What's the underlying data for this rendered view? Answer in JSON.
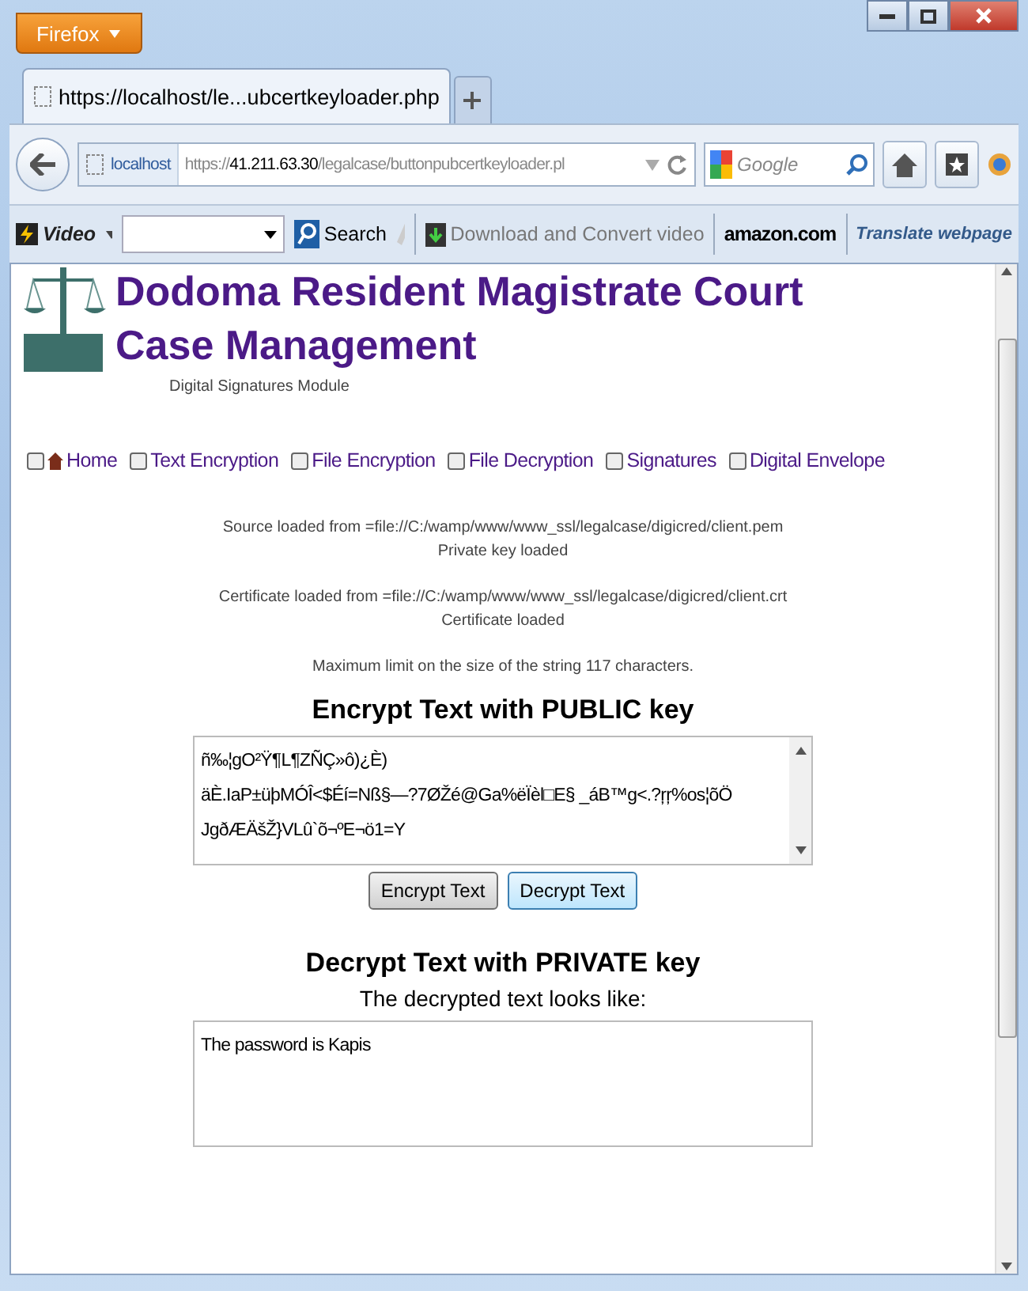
{
  "browser": {
    "app_button": "Firefox",
    "tabs": [
      {
        "label": "https://localhost/le...ubcertkeyloader.php",
        "selected": true
      }
    ],
    "address": {
      "site": "localhost",
      "scheme": "https://",
      "host": "41.211.63.30",
      "path": "/legalcase/buttonpubcertkeyloader.pl"
    },
    "search": {
      "placeholder": "Google"
    }
  },
  "toolbar": {
    "video": "Video",
    "search_button": "Search",
    "download": "Download and Convert video",
    "amazon": "amazon.com",
    "translate": "Translate webpage"
  },
  "page": {
    "title_lines": [
      "Dodoma Resident Magistrate Court",
      "Case Management"
    ],
    "subtitle": "Digital Signatures Module",
    "nav": [
      {
        "label": "Home",
        "kind": "home"
      },
      {
        "label": "Text Encryption",
        "kind": "link"
      },
      {
        "label": "File Encryption",
        "kind": "link"
      },
      {
        "label": "File Decryption",
        "kind": "link"
      },
      {
        "label": "Signatures",
        "kind": "link"
      },
      {
        "label": "Digital Envelope",
        "kind": "link"
      }
    ],
    "messages": [
      [
        "Source loaded from =file://C:/wamp/www/www_ssl/legalcase/digicred/client.pem",
        "Private key loaded"
      ],
      [
        "Certificate loaded from =file://C:/wamp/www/www_ssl/legalcase/digicred/client.crt",
        "Certificate loaded"
      ],
      [
        "Maximum limit on the size of the string 117 characters."
      ]
    ],
    "encrypt": {
      "heading": "Encrypt Text with PUBLIC key",
      "value": "ñ‰¦gO²Ÿ¶L¶ZÑÇ»ô)¿È)\näÈ.IaP±üþMÓÎ<$Éí=Nß§—?7ØŽé@Ga%ëÏèl□E§ _áB™g<.?ŗŗ%os¦õÖ\nJgðÆÄšŽ}VLû`õ¬ºE¬ö1=Y",
      "buttons": [
        {
          "label": "Encrypt Text",
          "highlighted": false
        },
        {
          "label": "Decrypt Text",
          "highlighted": true
        }
      ]
    },
    "decrypt": {
      "heading": "Decrypt Text with PRIVATE key",
      "caption": "The decrypted text looks like:",
      "value": "The password is Kapis"
    }
  }
}
